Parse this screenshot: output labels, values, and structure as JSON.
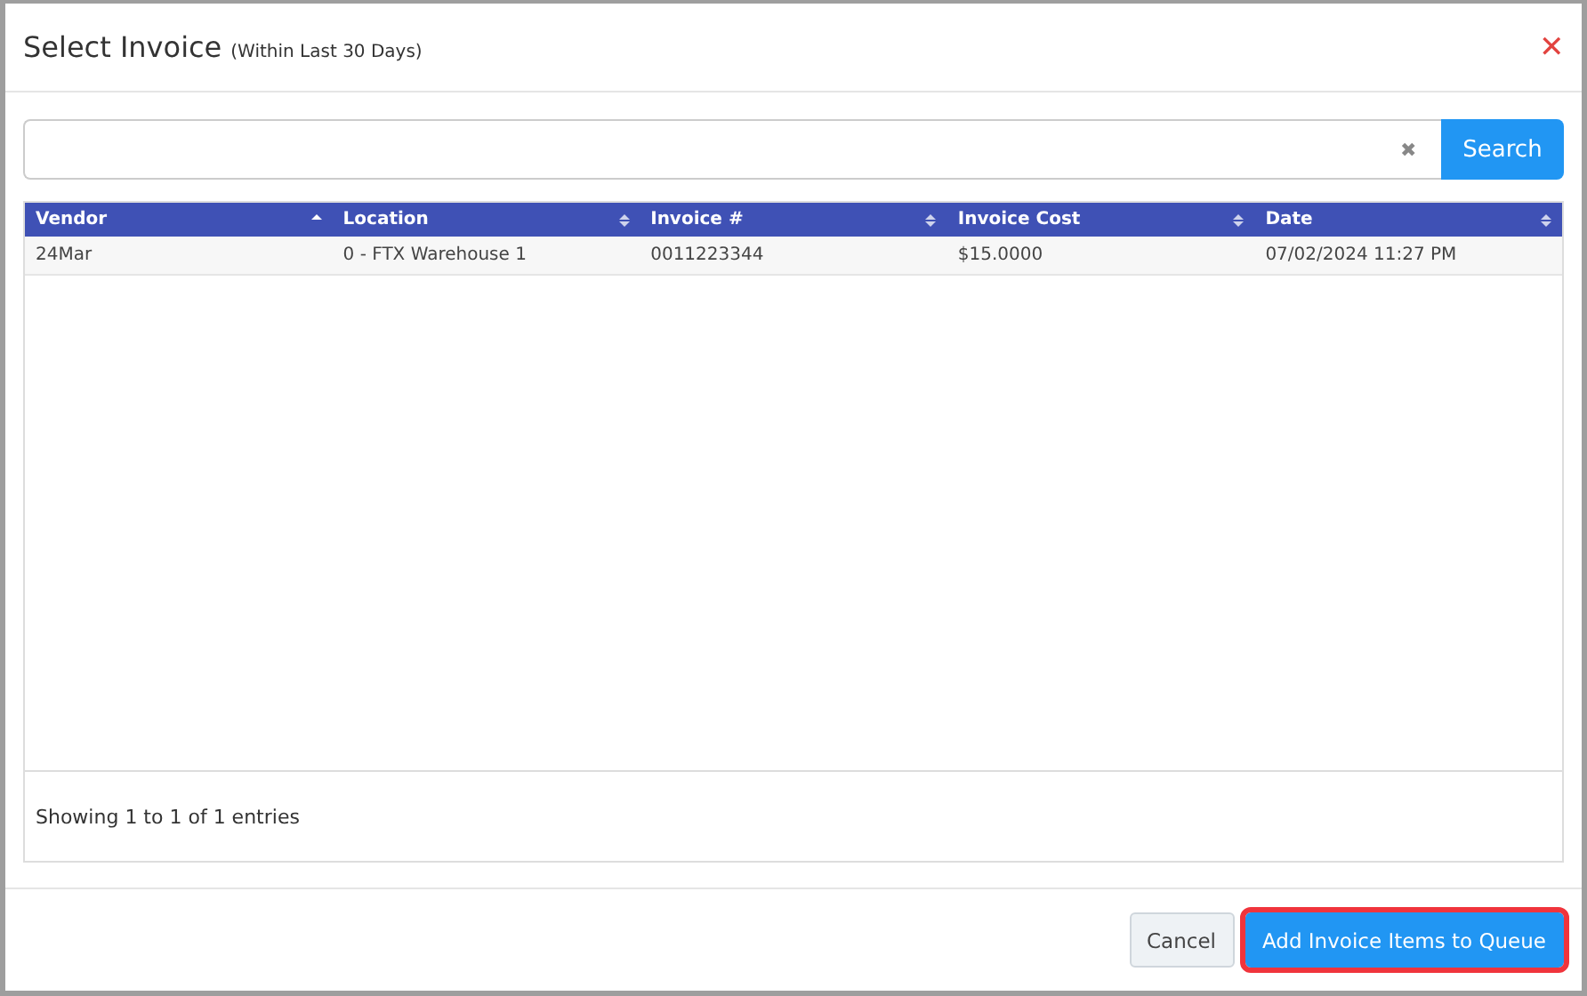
{
  "dialog": {
    "title": "Select Invoice",
    "subtitle": "(Within Last 30 Days)",
    "close": "✕"
  },
  "search": {
    "clear": "✖",
    "button": "Search"
  },
  "table": {
    "columns": [
      {
        "label": "Vendor",
        "sorted": true
      },
      {
        "label": "Location",
        "sorted": false
      },
      {
        "label": "Invoice #",
        "sorted": false
      },
      {
        "label": "Invoice Cost",
        "sorted": false
      },
      {
        "label": "Date",
        "sorted": false
      }
    ],
    "rows": [
      [
        "24Mar",
        "0 - FTX Warehouse 1",
        "0011223344",
        "$15.0000",
        "07/02/2024 11:27 PM"
      ]
    ],
    "info": "Showing 1 to 1 of 1 entries"
  },
  "buttons": [
    {
      "label": "Cancel",
      "kind": "secondary",
      "highlighted": false
    },
    {
      "label": "Add Invoice Items to Queue",
      "kind": "primary",
      "highlighted": true
    }
  ]
}
